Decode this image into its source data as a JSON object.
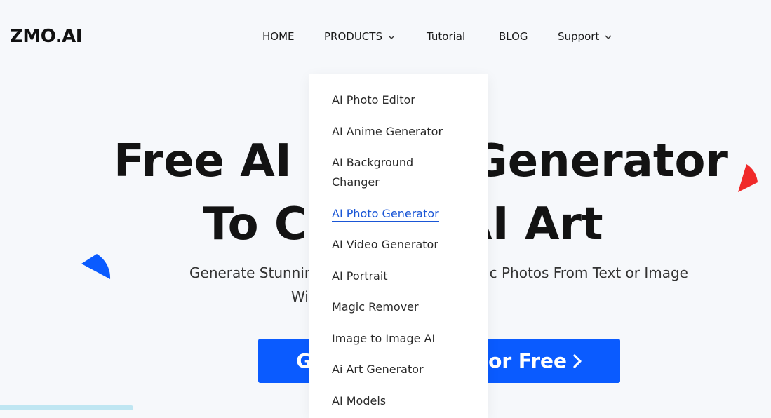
{
  "logo": {
    "text": "ZMO.AI"
  },
  "nav": {
    "items": [
      {
        "label": "HOME"
      },
      {
        "label": "PRODUCTS",
        "icon": "chevron-down-icon"
      },
      {
        "label": "Tutorial"
      },
      {
        "label": "BLOG"
      },
      {
        "label": "Support",
        "icon": "chevron-down-icon"
      }
    ]
  },
  "hero": {
    "title_line1": "Free AI Photo Generator",
    "title_line2": "To Create AI Art",
    "subtitle_line1": "Generate Stunning Art Images and Realistic Photos From Text or Image",
    "subtitle_line2": "With One Click Of A Button",
    "cta_label": "Generate AI Art For Free",
    "cta_icon": "chevron-right-icon"
  },
  "products_menu": {
    "items": [
      {
        "label": "AI Photo Editor"
      },
      {
        "label": "AI Anime Generator"
      },
      {
        "label": "AI Background Changer"
      },
      {
        "label": "AI Photo Generator",
        "active": true
      },
      {
        "label": "AI Video Generator"
      },
      {
        "label": "AI Portrait"
      },
      {
        "label": "Magic Remover"
      },
      {
        "label": "Image to Image AI"
      },
      {
        "label": "Ai Art Generator"
      },
      {
        "label": "AI Models"
      }
    ]
  },
  "colors": {
    "background": "#f6f8fb",
    "accent_blue": "#0a5bff",
    "active_link": "#1a56d6",
    "shape_red": "#f02a2a",
    "strip": "#bfe6f2"
  }
}
